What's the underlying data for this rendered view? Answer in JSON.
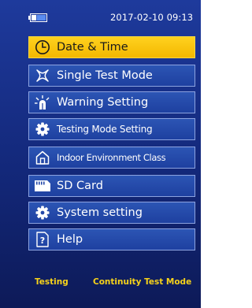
{
  "status": {
    "battery_icon": "battery-icon",
    "datetime": "2017-02-10 09:13"
  },
  "menu": {
    "items": [
      {
        "label": "Date & Time",
        "icon": "clock-icon",
        "selected": true
      },
      {
        "label": "Single Test Mode",
        "icon": "single-test-icon",
        "selected": false
      },
      {
        "label": "Warning Setting",
        "icon": "warning-light-icon",
        "selected": false
      },
      {
        "label": "Testing Mode Setting",
        "icon": "gear-icon",
        "selected": false
      },
      {
        "label": "Indoor Environment Class",
        "icon": "house-icon",
        "selected": false
      },
      {
        "label": "SD Card",
        "icon": "sd-card-icon",
        "selected": false
      },
      {
        "label": "System setting",
        "icon": "gear-icon",
        "selected": false
      },
      {
        "label": "Help",
        "icon": "help-icon",
        "selected": false
      }
    ]
  },
  "footer": {
    "status": "Testing",
    "mode": "Continuity Test Mode"
  },
  "colors": {
    "background_top": "#1e3a9c",
    "background_bottom": "#0d1a58",
    "item_fill": "#2c55b4",
    "item_border": "#8ca3e0",
    "selected_fill": "#ffd21f",
    "footer_text": "#f6d21a"
  }
}
